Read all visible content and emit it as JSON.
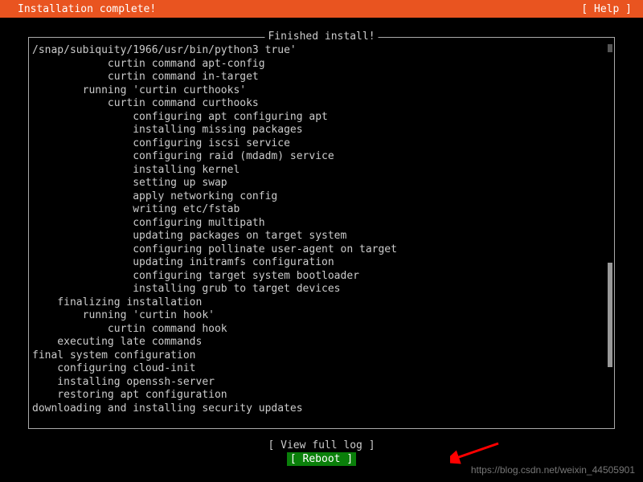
{
  "header": {
    "title": "Installation complete!",
    "help": "[ Help ]"
  },
  "panel": {
    "title": "Finished install!"
  },
  "log_lines": [
    {
      "indent": 0,
      "text": "/snap/subiquity/1966/usr/bin/python3 true'"
    },
    {
      "indent": 6,
      "text": "curtin command apt-config"
    },
    {
      "indent": 6,
      "text": "curtin command in-target"
    },
    {
      "indent": 4,
      "text": "running 'curtin curthooks'"
    },
    {
      "indent": 6,
      "text": "curtin command curthooks"
    },
    {
      "indent": 8,
      "text": "configuring apt configuring apt"
    },
    {
      "indent": 8,
      "text": "installing missing packages"
    },
    {
      "indent": 8,
      "text": "configuring iscsi service"
    },
    {
      "indent": 8,
      "text": "configuring raid (mdadm) service"
    },
    {
      "indent": 8,
      "text": "installing kernel"
    },
    {
      "indent": 8,
      "text": "setting up swap"
    },
    {
      "indent": 8,
      "text": "apply networking config"
    },
    {
      "indent": 8,
      "text": "writing etc/fstab"
    },
    {
      "indent": 8,
      "text": "configuring multipath"
    },
    {
      "indent": 8,
      "text": "updating packages on target system"
    },
    {
      "indent": 8,
      "text": "configuring pollinate user-agent on target"
    },
    {
      "indent": 8,
      "text": "updating initramfs configuration"
    },
    {
      "indent": 8,
      "text": "configuring target system bootloader"
    },
    {
      "indent": 8,
      "text": "installing grub to target devices"
    },
    {
      "indent": 2,
      "text": "finalizing installation"
    },
    {
      "indent": 4,
      "text": "running 'curtin hook'"
    },
    {
      "indent": 6,
      "text": "curtin command hook"
    },
    {
      "indent": 2,
      "text": "executing late commands"
    },
    {
      "indent": 0,
      "text": "final system configuration"
    },
    {
      "indent": 2,
      "text": "configuring cloud-init"
    },
    {
      "indent": 2,
      "text": "installing openssh-server"
    },
    {
      "indent": 2,
      "text": "restoring apt configuration"
    },
    {
      "indent": 0,
      "text": "downloading and installing security updates"
    }
  ],
  "buttons": {
    "view_log": "[ View full log ]",
    "reboot": "[ Reboot       ]"
  },
  "watermark": "https://blog.csdn.net/weixin_44505901"
}
